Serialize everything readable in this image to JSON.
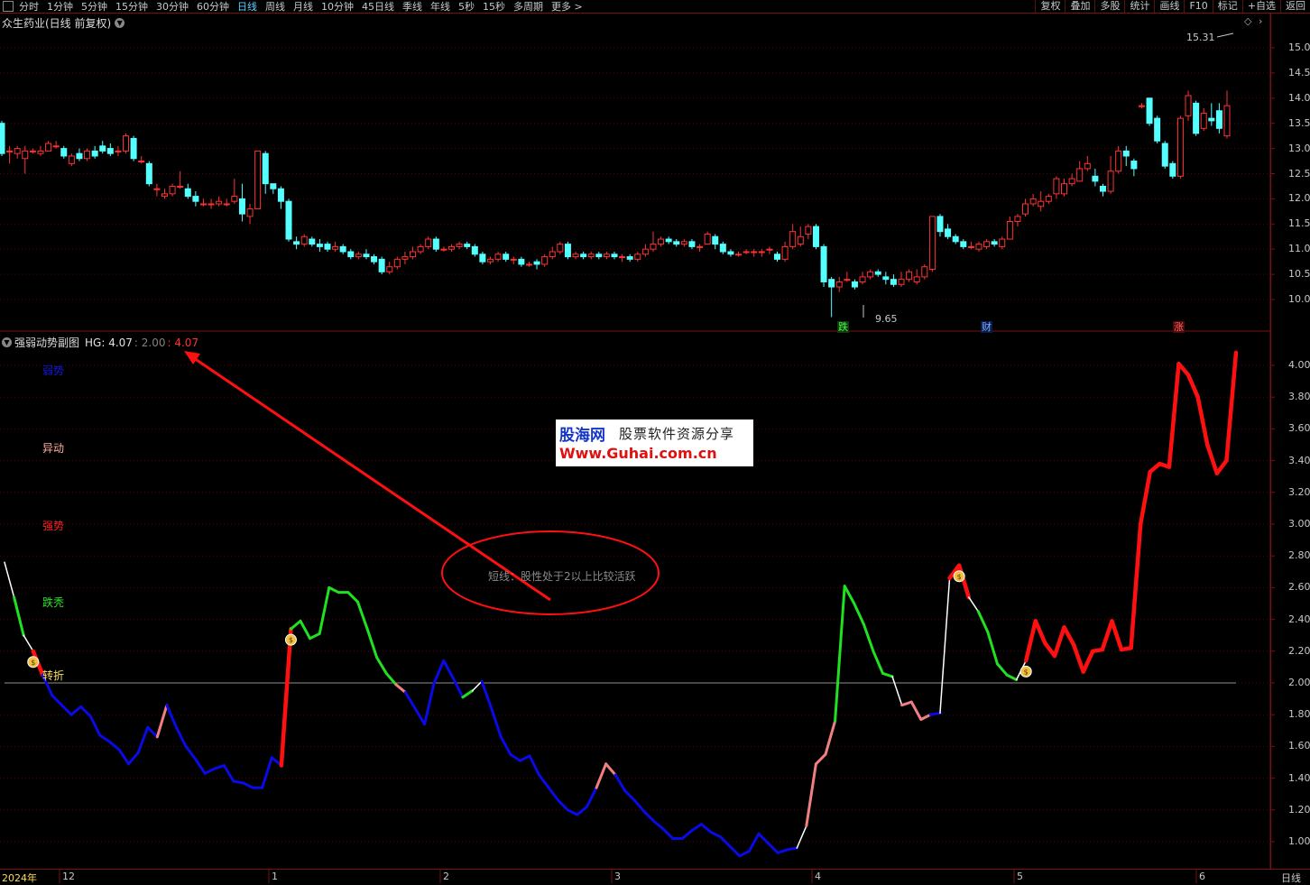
{
  "toolbar": {
    "periods": [
      "分时",
      "1分钟",
      "5分钟",
      "15分钟",
      "30分钟",
      "60分钟",
      "日线",
      "周线",
      "月线",
      "10分钟",
      "45日线",
      "季线",
      "年线",
      "5秒",
      "15秒",
      "多周期",
      "更多 >"
    ],
    "active": "日线",
    "right_buttons": [
      "复权",
      "叠加",
      "多股",
      "统计",
      "画线",
      "F10",
      "标记",
      "+自选",
      "返回"
    ]
  },
  "stock": {
    "title": "众生药业(日线 前复权)",
    "high_label": "15.31",
    "low_label": "9.65"
  },
  "price_axis": [
    "15.00",
    "14.50",
    "14.00",
    "13.50",
    "13.00",
    "12.50",
    "12.00",
    "11.50",
    "11.00",
    "10.50",
    "10.00"
  ],
  "markers": {
    "die": "跌",
    "cai": "财",
    "zhang": "涨"
  },
  "indicator": {
    "name": "强弱动势副图",
    "hg_label": "HG: 4.07",
    "v1": "2.00",
    "v2": "4.07"
  },
  "levels": {
    "ruoshi": {
      "text": "弱势",
      "color": "#1515e0"
    },
    "yidong": {
      "text": "异动",
      "color": "#ffb0a0"
    },
    "qiangshi": {
      "text": "强势",
      "color": "#ff2020"
    },
    "diexiu": {
      "text": "跌秃",
      "color": "#30e030"
    },
    "zhuanzhe": {
      "text": "转折",
      "color": "#ffe060"
    }
  },
  "ind_axis": [
    "4.00",
    "3.80",
    "3.60",
    "3.40",
    "3.20",
    "3.00",
    "2.80",
    "2.60",
    "2.40",
    "2.20",
    "2.00",
    "1.80",
    "1.60",
    "1.40",
    "1.20",
    "1.00"
  ],
  "watermark": {
    "line1": "股海网",
    "line1b": "股票软件资源分享",
    "line2": "Www.Guhai.com.cn"
  },
  "annotation": {
    "text": "短线：股性处于2以上比较活跃"
  },
  "bottom": {
    "year": "2024年",
    "months": [
      "12",
      "1",
      "2",
      "3",
      "4",
      "5",
      "6"
    ],
    "period": "日线"
  },
  "colors": {
    "up": "#ff3232",
    "down": "#54ffff",
    "grid": "#5a0000",
    "ruo": "#0a0ae6",
    "yi": "#f08080",
    "qiang": "#ff1010",
    "die": "#20e020",
    "zhuan": "#ffffff"
  },
  "chart_data": {
    "type": "line",
    "title": "强弱动势副图",
    "ylim": [
      0.9,
      4.1
    ],
    "reference_line": 2.0,
    "series": [
      {
        "name": "HG",
        "values": [
          2.76,
          2.54,
          2.3,
          2.2,
          2.05,
          1.92,
          1.86,
          1.8,
          1.85,
          1.79,
          1.67,
          1.63,
          1.58,
          1.49,
          1.56,
          1.72,
          1.66,
          1.86,
          1.72,
          1.6,
          1.52,
          1.43,
          1.46,
          1.48,
          1.38,
          1.37,
          1.34,
          1.34,
          1.53,
          1.48,
          2.34,
          2.39,
          2.28,
          2.31,
          2.6,
          2.57,
          2.57,
          2.51,
          2.34,
          2.16,
          2.06,
          1.99,
          1.94,
          1.84,
          1.74,
          2.0,
          2.14,
          2.03,
          1.91,
          1.95,
          2.01,
          1.84,
          1.66,
          1.55,
          1.51,
          1.54,
          1.42,
          1.34,
          1.26,
          1.2,
          1.17,
          1.22,
          1.34,
          1.49,
          1.42,
          1.32,
          1.26,
          1.19,
          1.13,
          1.08,
          1.02,
          1.02,
          1.07,
          1.11,
          1.06,
          1.03,
          0.97,
          0.91,
          0.94,
          1.05,
          0.99,
          0.93,
          0.95,
          0.96,
          1.1,
          1.49,
          1.55,
          1.76,
          2.61,
          2.5,
          2.37,
          2.2,
          2.06,
          2.04,
          1.86,
          1.88,
          1.77,
          1.8,
          1.81,
          2.66,
          2.74,
          2.54,
          2.45,
          2.32,
          2.12,
          2.05,
          2.02,
          2.14,
          2.39,
          2.25,
          2.17,
          2.35,
          2.24,
          2.07,
          2.2,
          2.21,
          2.39,
          2.21,
          2.22,
          3.0,
          3.33,
          3.38,
          3.36,
          4.01,
          3.94,
          3.8,
          3.5,
          3.32,
          3.4,
          4.08
        ],
        "states": [
          "qiang",
          "zhuan",
          "die",
          "zhuan",
          "qiang",
          "ruo",
          "ruo",
          "ruo",
          "ruo",
          "ruo",
          "ruo",
          "ruo",
          "ruo",
          "ruo",
          "ruo",
          "ruo",
          "ruo",
          "yi",
          "ruo",
          "ruo",
          "ruo",
          "ruo",
          "ruo",
          "ruo",
          "ruo",
          "ruo",
          "ruo",
          "ruo",
          "ruo",
          "ruo",
          "qiang",
          "die",
          "die",
          "die",
          "die",
          "die",
          "die",
          "die",
          "die",
          "die",
          "die",
          "die",
          "yi",
          "ruo",
          "ruo",
          "ruo",
          "ruo",
          "ruo",
          "ruo",
          "die",
          "zhuan",
          "ruo",
          "ruo",
          "ruo",
          "ruo",
          "ruo",
          "ruo",
          "ruo",
          "ruo",
          "ruo",
          "ruo",
          "ruo",
          "ruo",
          "yi",
          "yi",
          "ruo",
          "ruo",
          "ruo",
          "ruo",
          "ruo",
          "ruo",
          "ruo",
          "ruo",
          "ruo",
          "ruo",
          "ruo",
          "ruo",
          "ruo",
          "ruo",
          "ruo",
          "ruo",
          "ruo",
          "ruo",
          "ruo",
          "zhuan",
          "yi",
          "yi",
          "yi",
          "die",
          "die",
          "die",
          "die",
          "die",
          "die",
          "zhuan",
          "yi",
          "yi",
          "yi",
          "ruo",
          "zhuan",
          "qiang",
          "qiang",
          "zhuan",
          "die",
          "die",
          "die",
          "die",
          "zhuan",
          "qiang",
          "qiang",
          "qiang",
          "qiang",
          "qiang",
          "qiang",
          "qiang",
          "qiang",
          "qiang",
          "qiang",
          "qiang",
          "qiang",
          "qiang",
          "qiang",
          "qiang",
          "qiang",
          "qiang",
          "qiang",
          "qiang",
          "qiang",
          "qiang",
          "qiang",
          "qiang"
        ]
      }
    ],
    "signal_icons": [
      3,
      30,
      100,
      107
    ]
  },
  "candles": [
    [
      13.5,
      12.9,
      13.55,
      12.85
    ],
    [
      12.95,
      12.95,
      13.05,
      12.7
    ],
    [
      12.9,
      13.0,
      13.05,
      12.8
    ],
    [
      12.8,
      12.95,
      13.05,
      12.5
    ],
    [
      12.95,
      12.95,
      13.0,
      12.9
    ],
    [
      12.9,
      12.95,
      13.05,
      12.85
    ],
    [
      12.95,
      13.1,
      13.15,
      12.95
    ],
    [
      13.05,
      13.05,
      13.15,
      13.0
    ],
    [
      13.0,
      12.85,
      13.05,
      12.8
    ],
    [
      12.7,
      12.85,
      12.9,
      12.65
    ],
    [
      12.9,
      12.8,
      13.0,
      12.75
    ],
    [
      12.8,
      12.95,
      13.0,
      12.75
    ],
    [
      12.95,
      12.85,
      13.05,
      12.8
    ],
    [
      13.05,
      12.95,
      13.15,
      12.9
    ],
    [
      13.0,
      12.9,
      13.1,
      12.85
    ],
    [
      12.95,
      12.95,
      13.05,
      12.85
    ],
    [
      12.95,
      13.25,
      13.3,
      12.9
    ],
    [
      13.2,
      12.8,
      13.25,
      12.75
    ],
    [
      12.75,
      12.75,
      12.85,
      12.7
    ],
    [
      12.7,
      12.3,
      12.75,
      12.25
    ],
    [
      12.2,
      12.2,
      12.3,
      12.05
    ],
    [
      12.05,
      12.1,
      12.2,
      12.0
    ],
    [
      12.1,
      12.25,
      12.3,
      12.05
    ],
    [
      12.25,
      12.25,
      12.55,
      12.2
    ],
    [
      12.2,
      12.05,
      12.3,
      12.0
    ],
    [
      12.05,
      11.95,
      12.15,
      11.85
    ],
    [
      11.9,
      11.9,
      12.0,
      11.85
    ],
    [
      11.9,
      11.9,
      12.0,
      11.8
    ],
    [
      11.9,
      11.95,
      12.05,
      11.85
    ],
    [
      11.9,
      11.9,
      12.0,
      11.85
    ],
    [
      11.95,
      12.05,
      12.4,
      11.9
    ],
    [
      12.0,
      11.7,
      12.3,
      11.55
    ],
    [
      11.65,
      11.8,
      11.9,
      11.5
    ],
    [
      11.8,
      12.95,
      12.95,
      11.95
    ],
    [
      12.9,
      12.3,
      12.95,
      12.1
    ],
    [
      12.3,
      12.2,
      12.3,
      12.1
    ],
    [
      12.2,
      11.95,
      12.25,
      11.8
    ],
    [
      11.95,
      11.2,
      12.0,
      11.15
    ],
    [
      11.15,
      11.1,
      11.25,
      11.0
    ],
    [
      11.1,
      11.25,
      11.3,
      11.05
    ],
    [
      11.2,
      11.1,
      11.25,
      11.05
    ],
    [
      11.1,
      11.05,
      11.2,
      10.95
    ],
    [
      11.1,
      11.0,
      11.15,
      10.95
    ],
    [
      11.0,
      11.05,
      11.15,
      10.95
    ],
    [
      11.05,
      10.95,
      11.1,
      10.9
    ],
    [
      10.95,
      10.85,
      11.0,
      10.8
    ],
    [
      10.85,
      10.9,
      10.95,
      10.8
    ],
    [
      10.9,
      10.85,
      11.0,
      10.8
    ],
    [
      10.85,
      10.75,
      10.9,
      10.7
    ],
    [
      10.8,
      10.55,
      10.85,
      10.5
    ],
    [
      10.55,
      10.65,
      10.75,
      10.5
    ],
    [
      10.65,
      10.8,
      10.85,
      10.6
    ],
    [
      10.8,
      10.85,
      10.95,
      10.7
    ],
    [
      10.85,
      10.95,
      11.05,
      10.8
    ],
    [
      10.95,
      11.05,
      11.1,
      10.9
    ],
    [
      11.05,
      11.2,
      11.25,
      11.0
    ],
    [
      11.2,
      11.0,
      11.25,
      10.95
    ],
    [
      11.0,
      11.0,
      11.05,
      10.95
    ],
    [
      11.0,
      11.05,
      11.1,
      10.95
    ],
    [
      11.05,
      11.1,
      11.15,
      11.0
    ],
    [
      11.1,
      11.05,
      11.15,
      11.0
    ],
    [
      11.05,
      10.9,
      11.1,
      10.85
    ],
    [
      10.9,
      10.75,
      10.95,
      10.7
    ],
    [
      10.75,
      10.8,
      10.85,
      10.7
    ],
    [
      10.8,
      10.9,
      10.95,
      10.75
    ],
    [
      10.9,
      10.8,
      10.95,
      10.75
    ],
    [
      10.8,
      10.8,
      10.85,
      10.7
    ],
    [
      10.8,
      10.7,
      10.85,
      10.65
    ],
    [
      10.7,
      10.7,
      10.75,
      10.65
    ],
    [
      10.75,
      10.7,
      10.8,
      10.6
    ],
    [
      10.7,
      10.85,
      10.9,
      10.65
    ],
    [
      10.85,
      10.95,
      11.05,
      10.8
    ],
    [
      10.95,
      11.1,
      11.15,
      10.9
    ],
    [
      11.1,
      10.85,
      11.15,
      10.8
    ],
    [
      10.85,
      10.9,
      10.95,
      10.8
    ],
    [
      10.9,
      10.85,
      10.95,
      10.8
    ],
    [
      10.85,
      10.9,
      10.95,
      10.8
    ],
    [
      10.9,
      10.85,
      10.95,
      10.8
    ],
    [
      10.85,
      10.9,
      10.95,
      10.8
    ],
    [
      10.9,
      10.85,
      10.95,
      10.8
    ],
    [
      10.85,
      10.85,
      10.9,
      10.75
    ],
    [
      10.85,
      10.8,
      10.9,
      10.75
    ],
    [
      10.8,
      10.9,
      10.95,
      10.75
    ],
    [
      10.9,
      11.0,
      11.1,
      10.85
    ],
    [
      11.0,
      11.1,
      11.35,
      10.95
    ],
    [
      11.1,
      11.2,
      11.25,
      11.05
    ],
    [
      11.2,
      11.15,
      11.25,
      11.1
    ],
    [
      11.15,
      11.1,
      11.2,
      11.05
    ],
    [
      11.1,
      11.15,
      11.2,
      11.05
    ],
    [
      11.15,
      11.05,
      11.2,
      11.0
    ],
    [
      11.05,
      11.05,
      11.1,
      10.95
    ],
    [
      11.1,
      11.3,
      11.35,
      11.1
    ],
    [
      11.25,
      11.1,
      11.3,
      11.0
    ],
    [
      11.1,
      10.95,
      11.15,
      10.9
    ],
    [
      10.95,
      10.9,
      11.0,
      10.85
    ],
    [
      10.9,
      10.9,
      10.95,
      10.85
    ],
    [
      10.95,
      10.95,
      11.0,
      10.9
    ],
    [
      10.95,
      10.95,
      11.0,
      10.85
    ],
    [
      10.95,
      10.95,
      11.0,
      10.85
    ],
    [
      11.0,
      11.0,
      11.05,
      10.9
    ],
    [
      10.9,
      10.8,
      10.95,
      10.75
    ],
    [
      10.8,
      11.05,
      11.15,
      10.75
    ],
    [
      11.05,
      11.35,
      11.5,
      11.0
    ],
    [
      11.1,
      11.25,
      11.45,
      11.05
    ],
    [
      11.3,
      11.45,
      11.5,
      11.2
    ],
    [
      11.45,
      11.05,
      11.5,
      11.0
    ],
    [
      11.05,
      10.35,
      11.1,
      10.25
    ],
    [
      10.4,
      10.25,
      10.45,
      9.65
    ],
    [
      10.25,
      10.35,
      10.45,
      10.15
    ],
    [
      10.4,
      10.4,
      10.55,
      10.35
    ],
    [
      10.35,
      10.25,
      10.4,
      10.2
    ],
    [
      10.35,
      10.45,
      10.55,
      10.3
    ],
    [
      10.45,
      10.55,
      10.6,
      10.4
    ],
    [
      10.55,
      10.5,
      10.6,
      10.45
    ],
    [
      10.45,
      10.4,
      10.55,
      10.3
    ],
    [
      10.4,
      10.3,
      10.5,
      10.25
    ],
    [
      10.3,
      10.4,
      10.55,
      10.25
    ],
    [
      10.4,
      10.55,
      10.6,
      10.35
    ],
    [
      10.35,
      10.45,
      10.6,
      10.3
    ],
    [
      10.45,
      10.65,
      10.7,
      10.4
    ],
    [
      10.6,
      11.65,
      11.65,
      10.55
    ],
    [
      11.65,
      11.35,
      11.7,
      11.25
    ],
    [
      11.4,
      11.25,
      11.5,
      11.2
    ],
    [
      11.25,
      11.15,
      11.3,
      11.1
    ],
    [
      11.15,
      11.05,
      11.2,
      11.0
    ],
    [
      11.05,
      11.05,
      11.15,
      11.0
    ],
    [
      11.0,
      11.1,
      11.15,
      10.95
    ],
    [
      11.05,
      11.15,
      11.2,
      11.0
    ],
    [
      11.15,
      11.1,
      11.2,
      11.05
    ],
    [
      11.05,
      11.2,
      11.25,
      11.0
    ],
    [
      11.2,
      11.55,
      11.65,
      11.2
    ],
    [
      11.55,
      11.65,
      11.7,
      11.45
    ],
    [
      11.7,
      11.9,
      12.0,
      11.65
    ],
    [
      11.9,
      12.0,
      12.1,
      11.85
    ],
    [
      11.85,
      11.95,
      12.15,
      11.75
    ],
    [
      11.95,
      12.05,
      12.1,
      11.9
    ],
    [
      12.1,
      12.4,
      12.45,
      12.0
    ],
    [
      12.1,
      12.3,
      12.4,
      12.05
    ],
    [
      12.3,
      12.4,
      12.5,
      12.25
    ],
    [
      12.35,
      12.6,
      12.75,
      12.35
    ],
    [
      12.6,
      12.7,
      12.85,
      12.55
    ],
    [
      12.45,
      12.35,
      12.6,
      12.25
    ],
    [
      12.25,
      12.15,
      12.3,
      12.05
    ],
    [
      12.15,
      12.55,
      12.85,
      12.1
    ],
    [
      12.55,
      12.95,
      13.05,
      12.5
    ],
    [
      12.95,
      12.85,
      13.05,
      12.65
    ],
    [
      12.75,
      12.6,
      12.8,
      12.45
    ],
    [
      13.85,
      13.85,
      13.9,
      13.8
    ],
    [
      14.0,
      13.5,
      14.0,
      13.45
    ],
    [
      13.6,
      13.15,
      13.65,
      13.1
    ],
    [
      13.1,
      12.65,
      13.15,
      12.6
    ],
    [
      12.7,
      12.45,
      12.75,
      12.4
    ],
    [
      12.45,
      13.6,
      13.65,
      12.4
    ],
    [
      13.65,
      14.05,
      14.15,
      13.55
    ],
    [
      13.9,
      13.3,
      13.95,
      13.25
    ],
    [
      13.4,
      13.7,
      13.8,
      13.35
    ],
    [
      13.6,
      13.55,
      13.9,
      13.45
    ],
    [
      13.75,
      13.4,
      13.9,
      13.3
    ],
    [
      13.25,
      13.85,
      14.15,
      13.2
    ]
  ]
}
